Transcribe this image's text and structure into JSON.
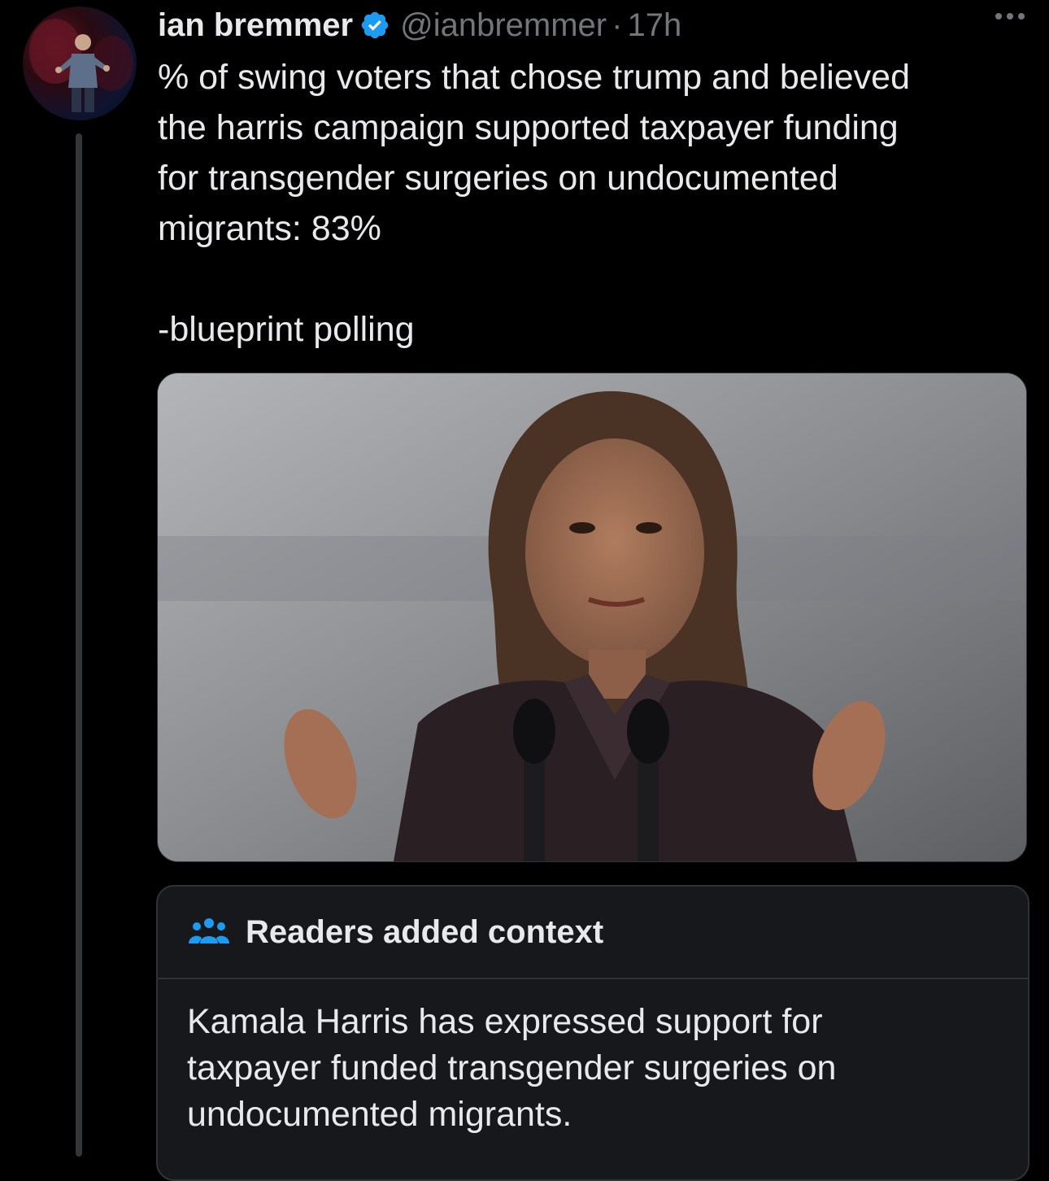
{
  "tweet": {
    "author": {
      "display_name": "ian bremmer",
      "handle": "@ianbremmer",
      "separator": "·",
      "time": "17h",
      "verified": true
    },
    "text_lines": [
      "% of swing voters that chose trump and believed",
      "the harris campaign supported taxpayer funding",
      "for transgender surgeries on undocumented",
      "migrants: 83%"
    ],
    "source_line": "-blueprint polling",
    "media": {
      "kind": "photo"
    }
  },
  "community_note": {
    "title": "Readers added context",
    "body_lines": [
      "Kamala Harris has expressed support for",
      "taxpayer funded transgender surgeries on",
      "undocumented migrants."
    ]
  },
  "icons": {
    "verified": "verified-badge-icon",
    "more": "more-options-icon",
    "notes": "people-icon"
  },
  "colors": {
    "background": "#000000",
    "text_primary": "#e7e9ea",
    "text_secondary": "#71767b",
    "accent_blue": "#1d9bf0",
    "border": "#2f3336",
    "note_bg": "#16181c"
  }
}
